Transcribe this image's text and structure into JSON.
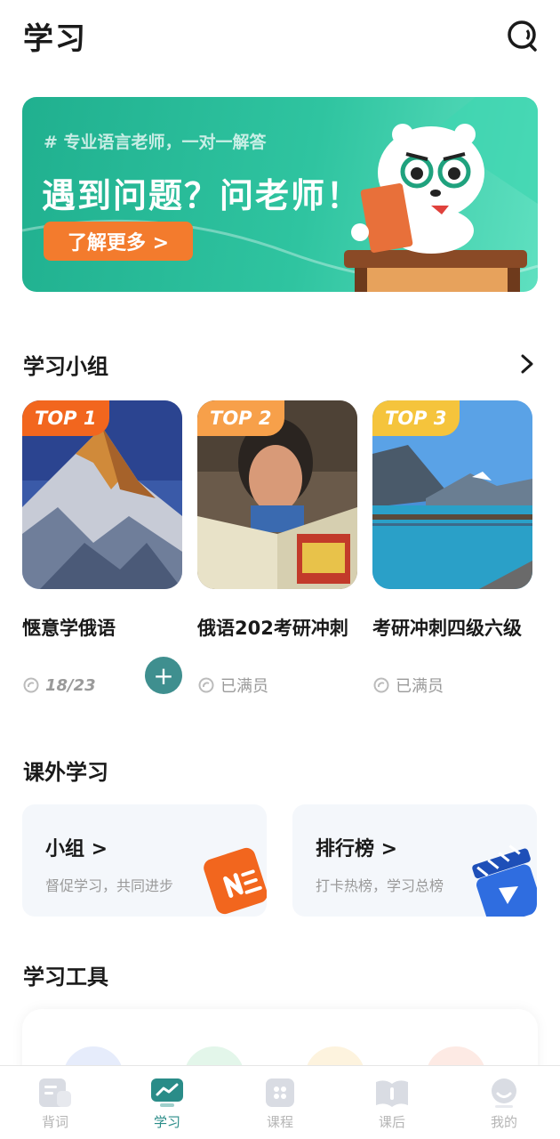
{
  "header": {
    "title": "学习"
  },
  "banner": {
    "subtitle": "# 专业语言老师，一对一解答",
    "title": "遇到问题？问老师！",
    "button": "了解更多 >"
  },
  "groups_section": {
    "title": "学习小组",
    "items": [
      {
        "rank": "TOP 1",
        "name": "惬意学俄语",
        "meta": "18/23",
        "join": "+"
      },
      {
        "rank": "TOP 2",
        "name": "俄语202考研冲刺",
        "meta": "已满员"
      },
      {
        "rank": "TOP 3",
        "name": "考研冲刺四级六级",
        "meta": "已满员"
      }
    ]
  },
  "extra_section": {
    "title": "课外学习",
    "cards": [
      {
        "title": "小组 >",
        "desc": "督促学习，共同进步"
      },
      {
        "title": "排行榜 >",
        "desc": "打卡热榜，学习总榜"
      }
    ]
  },
  "tools_section": {
    "title": "学习工具"
  },
  "tabbar": {
    "tabs": [
      {
        "label": "背词"
      },
      {
        "label": "学习"
      },
      {
        "label": "课程"
      },
      {
        "label": "课后"
      },
      {
        "label": "我的"
      }
    ]
  },
  "colors": {
    "accent": "#2a8c88",
    "banner": "#2fc4a0",
    "badge1": "#f2661e",
    "badge2": "#f7a04a",
    "badge3": "#f5c43c"
  }
}
